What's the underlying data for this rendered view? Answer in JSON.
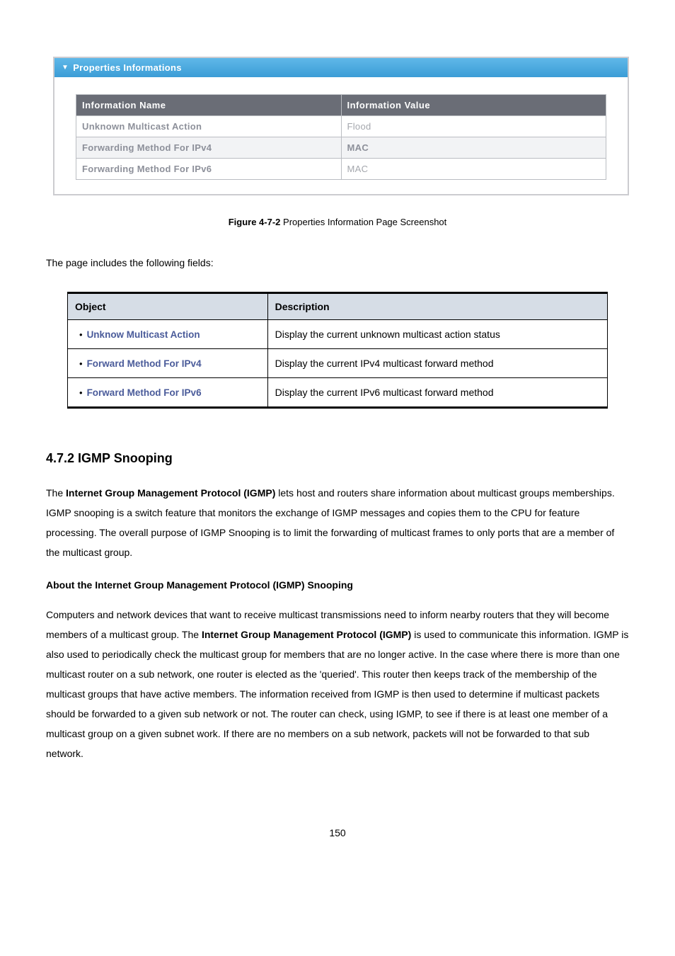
{
  "panel": {
    "title": "Properties Informations",
    "col_name": "Information Name",
    "col_value": "Information Value",
    "rows": [
      {
        "name": "Unknown Multicast Action",
        "value": "Flood"
      },
      {
        "name": "Forwarding Method For IPv4",
        "value": "MAC"
      },
      {
        "name": "Forwarding Method For IPv6",
        "value": "MAC"
      }
    ]
  },
  "figure": {
    "label": "Figure 4-7-2",
    "caption": "Properties Information Page Screenshot"
  },
  "intro": "The page includes the following fields:",
  "table": {
    "h1": "Object",
    "h2": "Description",
    "rows": [
      {
        "obj": "Unknow Multicast Action",
        "desc": "Display the current unknown multicast action status"
      },
      {
        "obj": "Forward Method For IPv4",
        "desc": "Display the current IPv4 multicast forward method"
      },
      {
        "obj": "Forward Method For IPv6",
        "desc": "Display the current IPv6 multicast forward method"
      }
    ]
  },
  "section": {
    "heading": "4.7.2 IGMP Snooping",
    "p1a": "The ",
    "p1b": "Internet Group Management Protocol (IGMP)",
    "p1c": " lets host and routers share information about multicast groups memberships. IGMP snooping is a switch feature that monitors the exchange of IGMP messages and copies them to the CPU for feature processing. The overall purpose of IGMP Snooping is to limit the forwarding of multicast frames to only ports that are a member of the multicast group.",
    "sub": "About the Internet Group Management Protocol (IGMP) Snooping",
    "p2a": "Computers and network devices that want to receive multicast transmissions need to inform nearby routers that they will become members of a multicast group. The ",
    "p2b": "Internet Group Management Protocol (IGMP)",
    "p2c": " is used to communicate this information. IGMP is also used to periodically check the multicast group for members that are no longer active. In the case where there is more than one multicast router on a sub network, one router is elected as the 'queried'. This router then keeps track of the membership of the multicast groups that have active members. The information received from IGMP is then used to determine if multicast packets should be forwarded to a given sub network or not. The router can check, using IGMP, to see if there is at least one member of a multicast group on a given subnet work. If there are no members on a sub network, packets will not be forwarded to that sub network."
  },
  "page_number": "150"
}
